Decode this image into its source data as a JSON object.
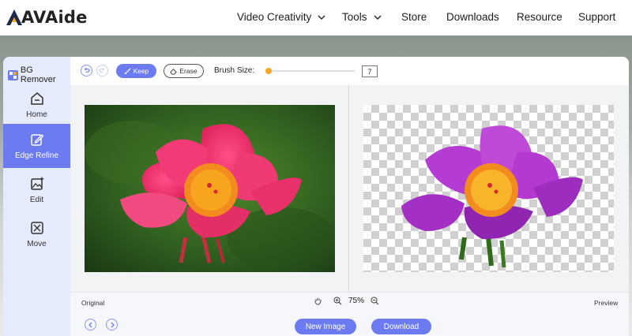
{
  "site": {
    "brand": "AVAide",
    "nav": [
      {
        "label": "Video Creativity",
        "has_dropdown": true
      },
      {
        "label": "Tools",
        "has_dropdown": true
      },
      {
        "label": "Store",
        "has_dropdown": false
      },
      {
        "label": "Downloads",
        "has_dropdown": false
      },
      {
        "label": "Resource",
        "has_dropdown": false
      },
      {
        "label": "Support",
        "has_dropdown": false
      }
    ]
  },
  "app": {
    "title": "BG Remover",
    "sidebar": [
      {
        "label": "Home",
        "icon": "home-icon",
        "active": false
      },
      {
        "label": "Edge Refine",
        "icon": "edit-square-icon",
        "active": true
      },
      {
        "label": "Edit",
        "icon": "image-edit-icon",
        "active": false
      },
      {
        "label": "Move",
        "icon": "move-icon",
        "active": false
      }
    ],
    "toolbar": {
      "keep_label": "Keep",
      "erase_label": "Erase",
      "brush_label": "Brush Size:",
      "brush_value": "7",
      "brush_fraction": 0.03
    },
    "status": {
      "original_label": "Original",
      "zoom": "75%",
      "preview_label": "Preview"
    },
    "actions": {
      "new_image": "New Image",
      "download": "Download"
    }
  },
  "colors": {
    "accent": "#6c7cf0",
    "slider": "#f5a623",
    "sidebar_bg": "#e6ebfb"
  }
}
